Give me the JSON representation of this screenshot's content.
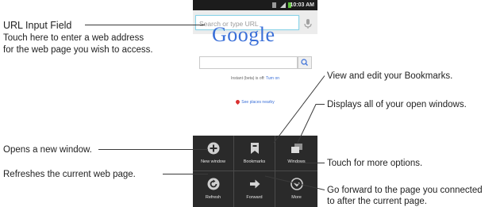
{
  "callouts": {
    "url_title": "URL Input Field",
    "url_desc_1": "Touch here to enter a web address",
    "url_desc_2": "for the web page you wish to access.",
    "bookmarks": "View and edit your Bookmarks.",
    "windows": "Displays all of your open windows.",
    "new_window": "Opens a new window.",
    "more": "Touch for more options.",
    "refresh": "Refreshes the current web page.",
    "forward_1": "Go forward to the page you connected",
    "forward_2": "to after the current page."
  },
  "phone": {
    "status_time": "10:03 AM",
    "url_placeholder": "Search or type URL",
    "logo": "Google",
    "instant_text": "Instant (beta) is off: ",
    "instant_link": "Turn on",
    "places_link": "See places nearby",
    "menu": [
      {
        "label": "New window",
        "icon": "plus-icon"
      },
      {
        "label": "Bookmarks",
        "icon": "bookmark-icon"
      },
      {
        "label": "Windows",
        "icon": "windows-icon"
      },
      {
        "label": "Refresh",
        "icon": "refresh-icon"
      },
      {
        "label": "Forward",
        "icon": "arrow-right-icon"
      },
      {
        "label": "More",
        "icon": "chevron-down-icon"
      }
    ]
  },
  "colors": {
    "menu_bg": "#2a2a2a",
    "logo_blue": "#3a6fd8",
    "url_border": "#8ad3e8"
  }
}
